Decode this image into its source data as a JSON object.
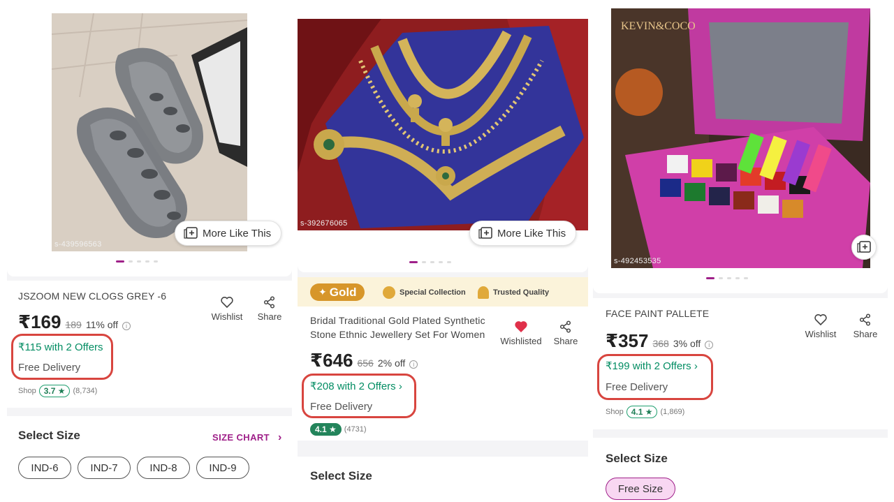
{
  "products": [
    {
      "sku": "s-439596563",
      "more_like_label": "More Like This",
      "title": "JSZOOM NEW CLOGS GREY -6",
      "price": "₹169",
      "mrp": "189",
      "discount": "11% off",
      "offers": "₹115 with 2 Offers",
      "delivery": "Free Delivery",
      "shop_label": "Shop",
      "rating": "3.7 ★",
      "reviews": "(8,734)",
      "wishlist_label": "Wishlist",
      "share_label": "Share",
      "select_size": "Select Size",
      "size_chart": "SIZE CHART",
      "sizes": [
        "IND-6",
        "IND-7",
        "IND-8",
        "IND-9"
      ]
    },
    {
      "sku": "s-392676065",
      "more_like_label": "More Like This",
      "gold_label": "Gold",
      "special_collection": "Special Collection",
      "trusted_quality": "Trusted Quality",
      "title_line1": "Bridal Traditional Gold Plated Synthetic",
      "title_line2": "Stone Ethnic Jewellery Set For Women",
      "price": "₹646",
      "mrp": "656",
      "discount": "2% off",
      "offers": "₹208 with 2 Offers ›",
      "delivery": "Free Delivery",
      "rating": "4.1 ★",
      "reviews": "(4731)",
      "wishlist_label": "Wishlisted",
      "share_label": "Share",
      "select_size": "Select Size"
    },
    {
      "sku": "s-492453535",
      "brand_overlay": "KEVIN&COCO",
      "title": "FACE PAINT PALLETE",
      "price": "₹357",
      "mrp": "368",
      "discount": "3% off",
      "offers": "₹199 with 2 Offers ›",
      "delivery": "Free Delivery",
      "shop_label": "Shop",
      "rating": "4.1 ★",
      "reviews": "(1,869)",
      "wishlist_label": "Wishlist",
      "share_label": "Share",
      "select_size": "Select Size",
      "sizes": [
        "Free Size"
      ]
    }
  ],
  "colors": {
    "accent": "#9f2089",
    "offer_green": "#038d63",
    "highlight_red": "#d8453f",
    "gold": "#d7962a",
    "wishlisted_heart": "#e0304a"
  }
}
